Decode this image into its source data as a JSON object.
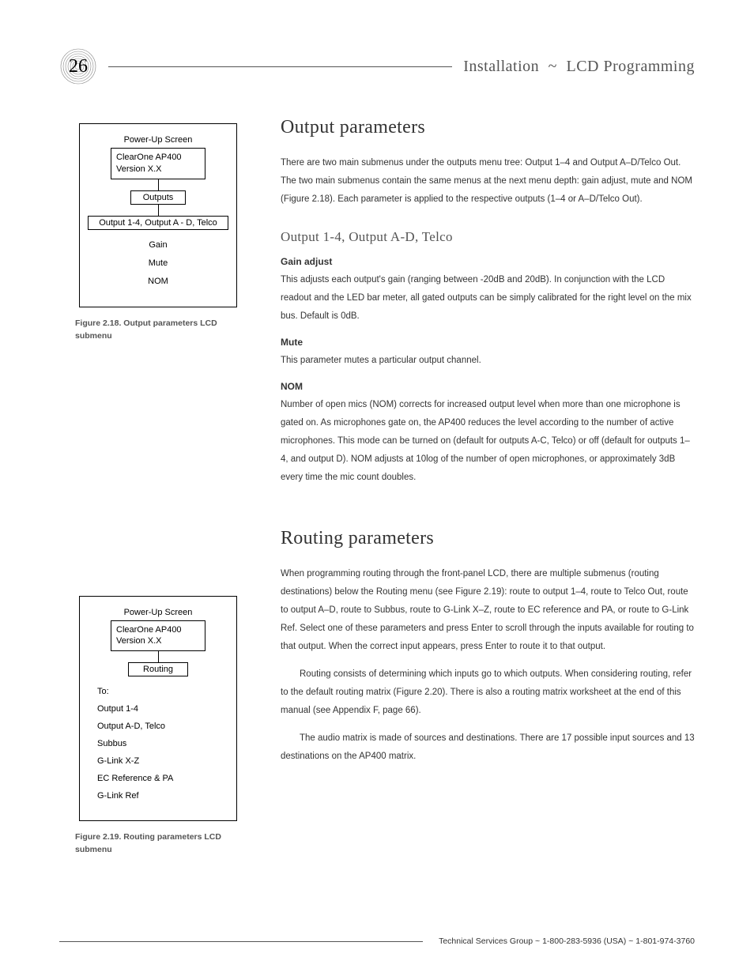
{
  "header": {
    "page_number": "26",
    "crumb1": "Installation",
    "tilde": "~",
    "crumb2": "LCD Programming"
  },
  "fig1": {
    "top_label": "Power-Up Screen",
    "brand_line1": "ClearOne AP400",
    "brand_line2": "Version X.X",
    "menu": "Outputs",
    "row": "Output 1-4, Output A - D, Telco",
    "items": [
      "Gain",
      "Mute",
      "NOM"
    ],
    "caption": "Figure 2.18.  Output parameters LCD submenu"
  },
  "fig2": {
    "top_label": "Power-Up Screen",
    "brand_line1": "ClearOne AP400",
    "brand_line2": "Version X.X",
    "menu": "Routing",
    "to": "To:",
    "items": [
      "Output 1-4",
      "Output A-D, Telco",
      "Subbus",
      "G-Link X-Z",
      "EC Reference & PA",
      "G-Link Ref"
    ],
    "caption": "Figure 2.19.  Routing parameters LCD submenu"
  },
  "section1": {
    "title": "Output parameters",
    "p1": "There are two main submenus under the outputs menu tree: Output 1–4 and Output A–D/Telco Out. The two main submenus contain the same menus at the next menu depth: gain adjust, mute and NOM (Figure 2.18). Each parameter is applied to the respective outputs (1–4 or A–D/Telco Out).",
    "subtitle": "Output 1-4, Output A-D, Telco",
    "h_gain": "Gain adjust",
    "p_gain": "This adjusts each output's gain (ranging between -20dB and 20dB). In conjunction with the LCD readout and the LED bar meter, all gated outputs can be simply calibrated for the right level on the mix bus. Default is 0dB.",
    "h_mute": "Mute",
    "p_mute": "This parameter mutes a particular output channel.",
    "h_nom": "NOM",
    "p_nom": "Number of open mics (NOM) corrects for increased output level when more than one microphone is gated on. As microphones gate on, the AP400 reduces the level according to the number of active microphones. This mode can be turned on (default for outputs A-C, Telco) or off (default for outputs 1–4, and output D). NOM adjusts at 10log of the number of open microphones, or approximately 3dB every time the mic count doubles."
  },
  "section2": {
    "title": "Routing parameters",
    "p1": "When programming routing through the front-panel LCD, there are multiple submenus (routing destinations) below the Routing menu (see Figure 2.19): route to output 1–4, route to Telco Out, route to output A–D, route to Subbus, route to G-Link X–Z, route to EC reference and PA, or route to G-Link Ref. Select one of these parameters and press Enter to scroll through the inputs available for routing to that output. When the correct input appears, press Enter to route it to that output.",
    "p2": "Routing consists of determining which inputs go to which outputs. When considering routing, refer to the default routing matrix (Figure 2.20). There is also a routing matrix worksheet at the end of this manual (see Appendix F, page 66).",
    "p3": "The audio matrix is made of sources and destinations. There are 17 possible input sources and 13 destinations on the AP400 matrix."
  },
  "footer": {
    "text": "Technical Services Group ~ 1-800-283-5936 (USA) ~ 1-801-974-3760"
  }
}
